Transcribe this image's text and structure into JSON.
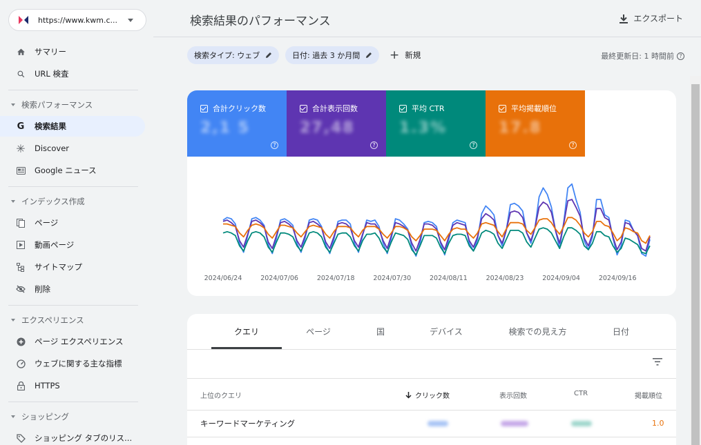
{
  "property": {
    "url": "https://www.kwm.c..."
  },
  "header": {
    "title": "検索結果のパフォーマンス",
    "export_label": "エクスポート"
  },
  "filters": {
    "chips": [
      "検索タイプ: ウェブ",
      "日付: 過去 3 か月間"
    ],
    "new_label": "新規",
    "last_updated": "最終更新日: 1 時間前"
  },
  "sidebar": {
    "items": [
      {
        "label": "サマリー",
        "icon": "home-icon"
      },
      {
        "label": "URL 検査",
        "icon": "search-icon"
      }
    ],
    "sections": [
      {
        "title": "検索パフォーマンス",
        "items": [
          {
            "label": "検索結果",
            "icon": "google-g-icon",
            "active": true
          },
          {
            "label": "Discover",
            "icon": "asterisk-icon"
          },
          {
            "label": "Google ニュース",
            "icon": "news-icon"
          }
        ]
      },
      {
        "title": "インデックス作成",
        "items": [
          {
            "label": "ページ",
            "icon": "pages-icon"
          },
          {
            "label": "動画ページ",
            "icon": "video-icon"
          },
          {
            "label": "サイトマップ",
            "icon": "sitemap-icon"
          },
          {
            "label": "削除",
            "icon": "eye-off-icon"
          }
        ]
      },
      {
        "title": "エクスペリエンス",
        "items": [
          {
            "label": "ページ エクスペリエンス",
            "icon": "plus-circle-icon"
          },
          {
            "label": "ウェブに関する主な指標",
            "icon": "gauge-icon"
          },
          {
            "label": "HTTPS",
            "icon": "lock-icon"
          }
        ]
      },
      {
        "title": "ショッピング",
        "items": [
          {
            "label": "ショッピング タブのリス...",
            "icon": "tag-icon"
          }
        ]
      }
    ]
  },
  "metrics": [
    {
      "label": "合計クリック数",
      "color": "#4285f4"
    },
    {
      "label": "合計表示回数",
      "color": "#5e35b1"
    },
    {
      "label": "平均 CTR",
      "color": "#00897b"
    },
    {
      "label": "平均掲載順位",
      "color": "#e8710a"
    }
  ],
  "chart_data": {
    "type": "line",
    "x_tick_labels": [
      "2024/06/24",
      "2024/07/06",
      "2024/07/18",
      "2024/07/30",
      "2024/08/11",
      "2024/08/23",
      "2024/09/04",
      "2024/09/16"
    ],
    "series": [
      {
        "metric": "合計クリック数",
        "color": "#4285f4",
        "values": [
          30,
          32,
          31,
          27,
          12,
          5,
          18,
          31,
          32,
          30,
          26,
          11,
          4,
          16,
          30,
          31,
          29,
          26,
          12,
          5,
          16,
          30,
          31,
          30,
          25,
          11,
          4,
          15,
          29,
          30,
          30,
          27,
          12,
          5,
          18,
          30,
          29,
          30,
          25,
          12,
          4,
          16,
          31,
          30,
          27,
          23,
          9,
          2,
          12,
          28,
          29,
          28,
          25,
          12,
          3,
          15,
          28,
          30,
          29,
          28,
          12,
          6,
          15,
          35,
          41,
          38,
          34,
          18,
          10,
          22,
          42,
          43,
          41,
          37,
          20,
          12,
          24,
          48,
          55,
          50,
          40,
          22,
          8,
          28,
          55,
          58,
          46,
          36,
          14,
          7,
          17,
          46,
          46,
          34,
          32,
          16,
          3,
          10,
          30,
          29,
          22,
          18,
          4,
          2,
          15
        ]
      },
      {
        "metric": "合計表示回数",
        "color": "#5e35b1",
        "values": [
          29,
          30,
          28,
          25,
          14,
          9,
          19,
          29,
          30,
          28,
          25,
          13,
          8,
          18,
          28,
          29,
          27,
          24,
          14,
          9,
          18,
          28,
          29,
          27,
          24,
          13,
          8,
          17,
          27,
          28,
          27,
          24,
          14,
          9,
          19,
          28,
          27,
          27,
          23,
          14,
          8,
          18,
          28,
          27,
          25,
          22,
          12,
          6,
          15,
          27,
          27,
          26,
          23,
          13,
          7,
          17,
          26,
          28,
          27,
          26,
          14,
          9,
          17,
          31,
          35,
          33,
          30,
          18,
          12,
          22,
          36,
          37,
          36,
          32,
          20,
          14,
          24,
          40,
          44,
          42,
          36,
          22,
          12,
          27,
          45,
          46,
          40,
          33,
          16,
          10,
          19,
          39,
          39,
          32,
          30,
          17,
          7,
          13,
          28,
          27,
          22,
          18,
          8,
          6,
          17
        ]
      },
      {
        "metric": "平均 CTR",
        "color": "#00897b",
        "values": [
          20,
          21,
          20,
          18,
          10,
          6,
          14,
          20,
          21,
          20,
          17,
          9,
          5,
          13,
          20,
          20,
          19,
          17,
          10,
          6,
          13,
          20,
          21,
          20,
          17,
          9,
          5,
          12,
          19,
          20,
          20,
          17,
          10,
          6,
          14,
          19,
          19,
          20,
          16,
          9,
          5,
          13,
          20,
          19,
          18,
          15,
          7,
          3,
          10,
          18,
          18,
          18,
          16,
          9,
          4,
          12,
          18,
          19,
          19,
          18,
          10,
          6,
          12,
          20,
          22,
          21,
          19,
          12,
          8,
          15,
          22,
          22,
          22,
          20,
          13,
          9,
          16,
          23,
          24,
          23,
          20,
          14,
          8,
          17,
          24,
          24,
          22,
          19,
          10,
          7,
          12,
          21,
          21,
          18,
          17,
          10,
          5,
          8,
          16,
          15,
          13,
          11,
          5,
          4,
          10
        ]
      },
      {
        "metric": "平均掲載順位",
        "color": "#e8710a",
        "values": [
          27,
          27,
          26,
          25,
          20,
          17,
          22,
          26,
          27,
          26,
          24,
          19,
          16,
          21,
          26,
          26,
          25,
          24,
          20,
          17,
          21,
          25,
          26,
          25,
          24,
          19,
          16,
          21,
          25,
          25,
          25,
          24,
          20,
          17,
          22,
          25,
          25,
          25,
          23,
          19,
          16,
          20,
          25,
          25,
          24,
          22,
          17,
          14,
          18,
          23,
          23,
          23,
          22,
          18,
          14,
          19,
          23,
          24,
          23,
          23,
          19,
          16,
          20,
          27,
          28,
          27,
          26,
          21,
          17,
          23,
          28,
          28,
          28,
          27,
          22,
          19,
          24,
          30,
          31,
          31,
          28,
          23,
          19,
          25,
          32,
          32,
          30,
          26,
          20,
          17,
          21,
          29,
          29,
          26,
          25,
          20,
          14,
          17,
          24,
          23,
          21,
          20,
          14,
          12,
          18
        ]
      }
    ]
  },
  "table": {
    "tabs": [
      "クエリ",
      "ページ",
      "国",
      "デバイス",
      "検索での見え方",
      "日付"
    ],
    "columns": [
      "上位のクエリ",
      "クリック数",
      "表示回数",
      "CTR",
      "掲載順位"
    ],
    "rows": [
      {
        "query": "キーワードマーケティング",
        "position": "1.0"
      }
    ]
  }
}
